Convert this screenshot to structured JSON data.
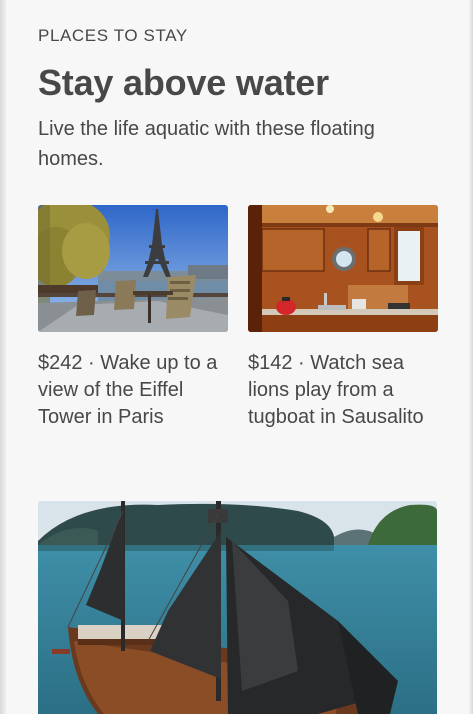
{
  "section": {
    "eyebrow": "PLACES TO STAY",
    "title": "Stay above water",
    "subtitle": "Live the life aquatic with these floating homes."
  },
  "listings": [
    {
      "price": "$242",
      "separator": " · ",
      "description": "Wake up to a view of the Eiffel Tower in Paris",
      "image": "eiffel-houseboat-deck-photo"
    },
    {
      "price": "$142",
      "separator": " · ",
      "description": "Watch sea lions play from a tugboat in Sausalito",
      "image": "tugboat-wooden-kitchen-photo"
    },
    {
      "image": "junk-ship-bay-photo"
    }
  ]
}
